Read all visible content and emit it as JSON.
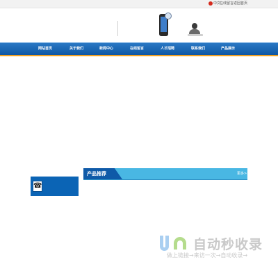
{
  "topbar": {
    "links": [
      {
        "label": "中文"
      },
      {
        "label": "在线留言"
      },
      {
        "label": "返回首页"
      }
    ]
  },
  "nav": {
    "items": [
      {
        "label": "网站首页"
      },
      {
        "label": "关于我们"
      },
      {
        "label": "新闻中心"
      },
      {
        "label": "在线留言"
      },
      {
        "label": "人才招聘"
      },
      {
        "label": "联系我们"
      },
      {
        "label": "产品展示"
      }
    ]
  },
  "contact_box": {
    "icon": "handset-icon",
    "glyph": "☎"
  },
  "products": {
    "title": "产品推荐",
    "more_label": "更多>>"
  },
  "watermark": {
    "text": "自动秒收录",
    "subtext": "做上链接→来访一次→自动收录→"
  },
  "colors": {
    "nav_blue": "#0d57a4",
    "nav_accent": "#f0a020",
    "product_bar": "#49b7e3",
    "product_title": "#0f5aa8"
  }
}
